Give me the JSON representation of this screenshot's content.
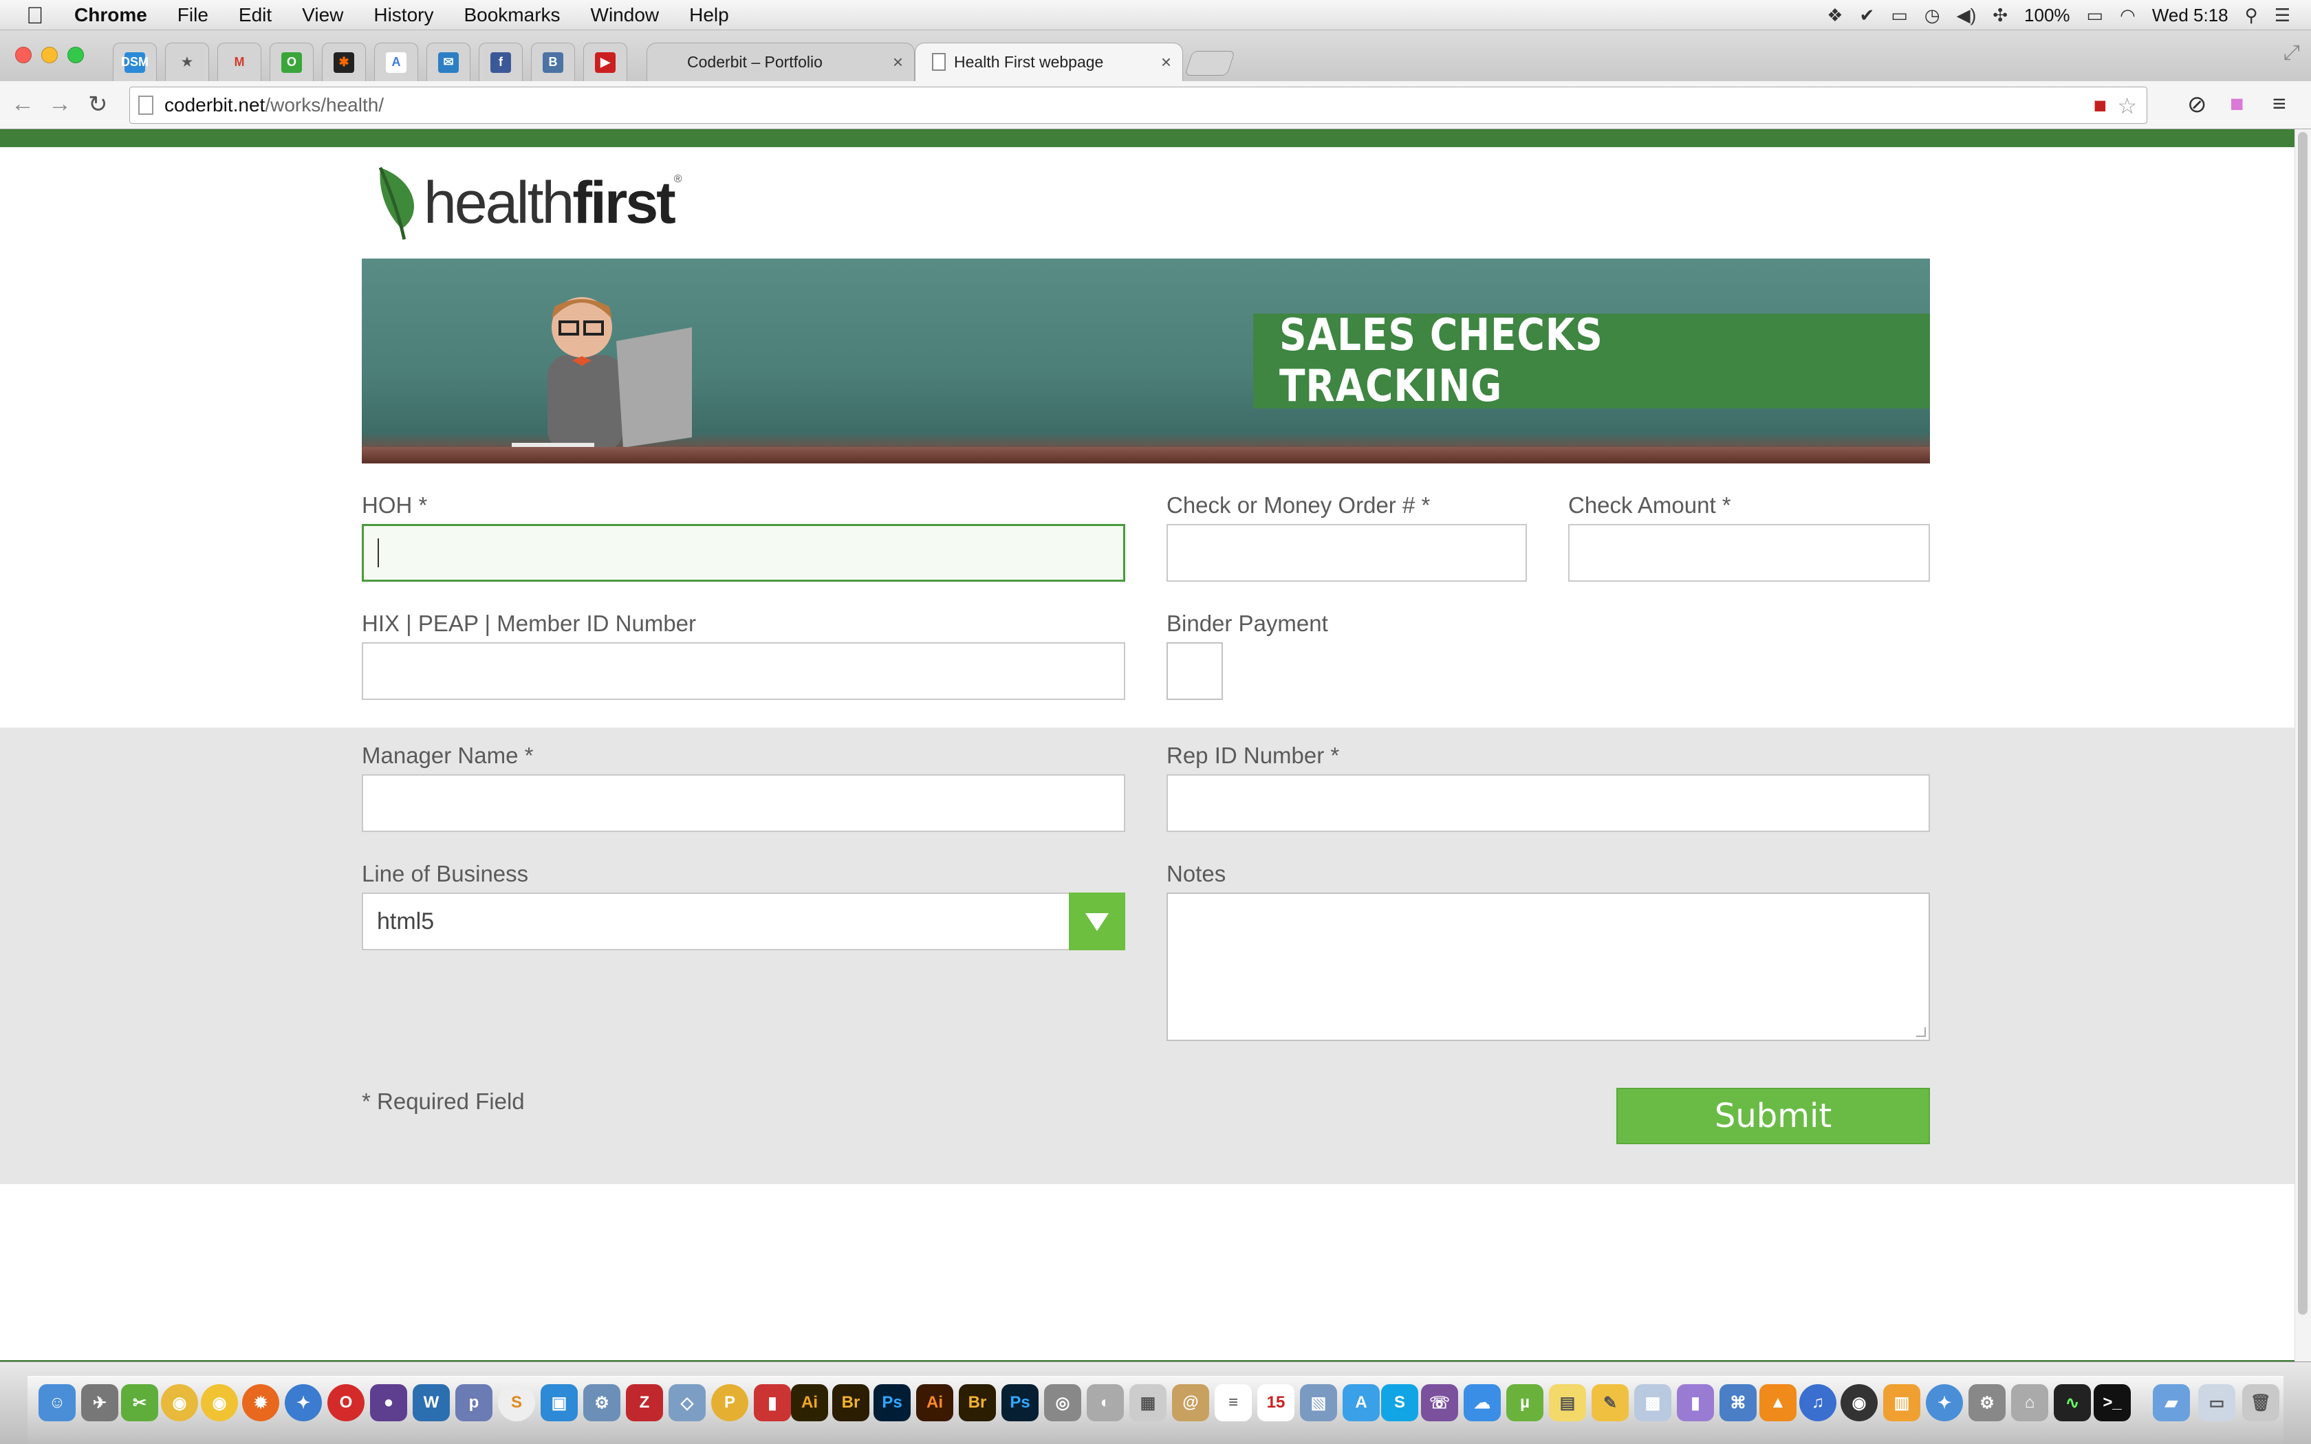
{
  "menubar": {
    "app": "Chrome",
    "items": [
      "File",
      "Edit",
      "View",
      "History",
      "Bookmarks",
      "Window",
      "Help"
    ],
    "battery": "100%",
    "clock": "Wed 5:18"
  },
  "tabs": {
    "pinned_icons": [
      "dsm-icon",
      "star-icon",
      "gmail-icon",
      "odnoklassniki-icon",
      "lastfm-icon",
      "translate-icon",
      "mail-icon",
      "facebook-icon",
      "vk-icon",
      "youtube-icon"
    ],
    "pinned_labels": [
      "DSM",
      "★",
      "M",
      "O",
      "✱",
      "A",
      "✉",
      "f",
      "B",
      "▶"
    ],
    "items": [
      {
        "title": "Coderbit – Portfolio"
      },
      {
        "title": "Health First webpage"
      }
    ]
  },
  "address": {
    "host": "coderbit.net",
    "path": "/works/health/"
  },
  "site": {
    "logo_regular": "health",
    "logo_bold": "first",
    "logo_mark": "®",
    "banner_title": "SALES CHECKS TRACKING",
    "colors": {
      "brand_green": "#3f7f39",
      "button_green": "#6abb46",
      "focus_green": "#4a9a3c"
    }
  },
  "form": {
    "hoh_label": "HOH *",
    "check_number_label": "Check or Money Order # *",
    "check_amount_label": "Check Amount *",
    "member_id_label": "HIX | PEAP | Member ID Number",
    "binder_label": "Binder Payment",
    "manager_label": "Manager Name *",
    "rep_id_label": "Rep ID Number *",
    "lob_label": "Line of Business",
    "lob_value": "html5",
    "notes_label": "Notes",
    "required_note": "* Required Field",
    "submit_label": "Submit"
  }
}
